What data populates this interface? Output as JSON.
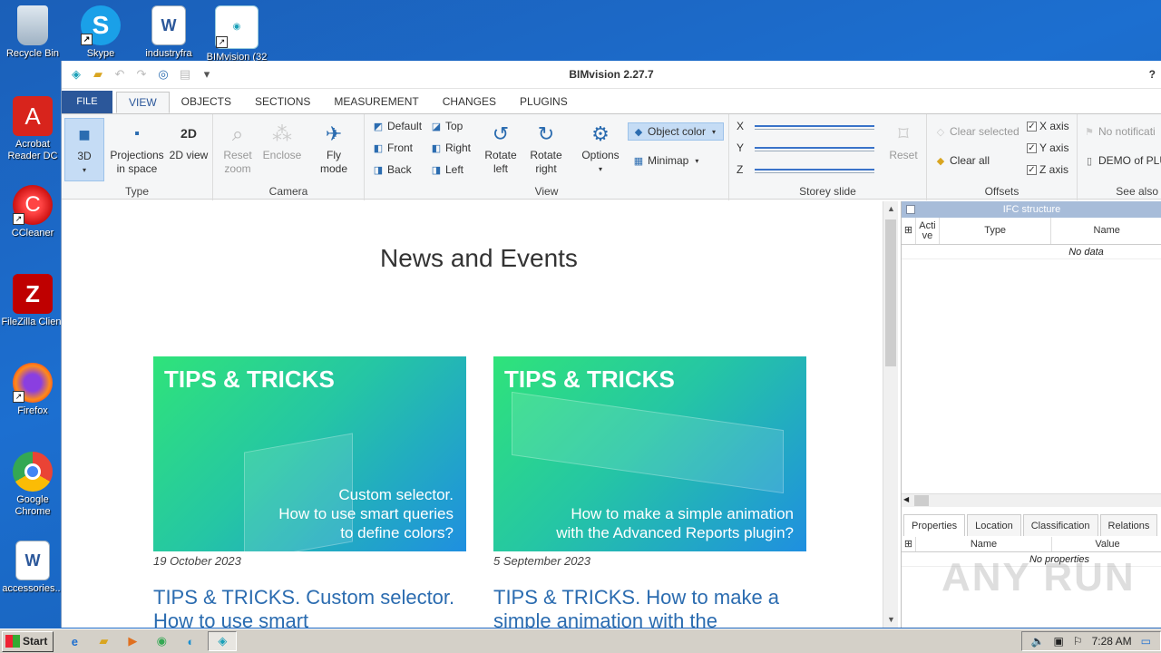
{
  "desktop": {
    "top_icons": [
      {
        "label": "Recycle Bin",
        "icon": "recycle-bin-icon"
      },
      {
        "label": "Skype",
        "icon": "skype-icon"
      },
      {
        "label": "industryfra",
        "icon": "word-doc-icon"
      },
      {
        "label": "BIMvision (32",
        "icon": "bimvision-icon"
      }
    ],
    "side_icons": [
      {
        "label": "Acrobat Reader DC",
        "icon": "acrobat-icon"
      },
      {
        "label": "CCleaner",
        "icon": "ccleaner-icon"
      },
      {
        "label": "FileZilla Client",
        "icon": "filezilla-icon"
      },
      {
        "label": "Firefox",
        "icon": "firefox-icon"
      },
      {
        "label": "Google Chrome",
        "icon": "chrome-icon"
      },
      {
        "label": "accessories...",
        "icon": "word-doc-icon"
      }
    ]
  },
  "window": {
    "title": "BIMvision 2.27.7",
    "help": "?"
  },
  "tabs": [
    "FILE",
    "VIEW",
    "OBJECTS",
    "SECTIONS",
    "MEASUREMENT",
    "CHANGES",
    "PLUGINS"
  ],
  "ribbon": {
    "type_group": {
      "label": "Type",
      "btn_3d": "3D",
      "btn_proj": "Projections in space",
      "btn_2d": "2D view"
    },
    "camera_group": {
      "label": "Camera",
      "reset_zoom": "Reset zoom",
      "enclose": "Enclose",
      "fly_mode": "Fly mode"
    },
    "view_group": {
      "label": "View",
      "default": "Default",
      "front": "Front",
      "back": "Back",
      "top": "Top",
      "right": "Right",
      "left": "Left",
      "rotate_left": "Rotate left",
      "rotate_right": "Rotate right",
      "options": "Options",
      "object_color": "Object color",
      "minimap": "Minimap"
    },
    "storey_group": {
      "label": "Storey slide",
      "x": "X",
      "y": "Y",
      "z": "Z",
      "reset": "Reset"
    },
    "offsets_group": {
      "label": "Offsets",
      "clear_selected": "Clear selected",
      "clear_all": "Clear all",
      "x_axis": "X axis",
      "y_axis": "Y axis",
      "z_axis": "Z axis"
    },
    "seealso_group": {
      "label": "See also",
      "no_notif": "No notificati",
      "demo": "DEMO of PLU"
    }
  },
  "news": {
    "title": "News and Events",
    "cards": [
      {
        "banner_heading": "TIPS & TRICKS",
        "banner_caption": "Custom selector.\nHow to use smart queries\nto define colors?",
        "date": "19 October 2023",
        "title": "TIPS & TRICKS. Custom selector. How to use smart"
      },
      {
        "banner_heading": "TIPS & TRICKS",
        "banner_caption": "How to make a simple animation\nwith the Advanced Reports plugin?",
        "date": "5 September 2023",
        "title": "TIPS & TRICKS. How to make a simple animation with the"
      }
    ]
  },
  "ifc_panel": {
    "title": "IFC structure",
    "col_active": "Acti ve",
    "col_type": "Type",
    "col_name": "Name",
    "no_data": "No data"
  },
  "props_panel": {
    "tabs": [
      "Properties",
      "Location",
      "Classification",
      "Relations"
    ],
    "col_name": "Name",
    "col_value": "Value",
    "no_props": "No properties"
  },
  "taskbar": {
    "start": "Start",
    "clock": "7:28 AM"
  },
  "watermark": "ANY RUN"
}
